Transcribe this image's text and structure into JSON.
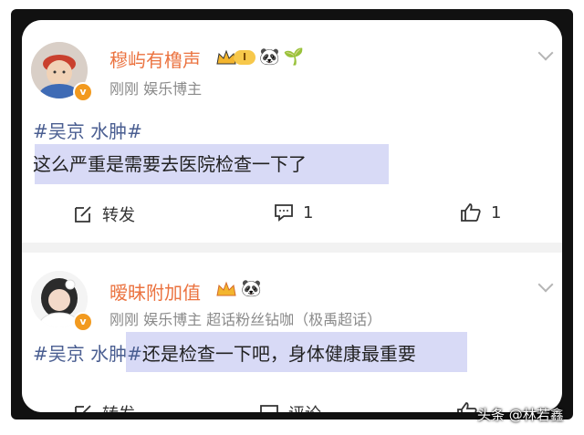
{
  "posts": [
    {
      "username": "穆屿有橹声",
      "level_badge": "I",
      "meta": "刚刚  娱乐博主",
      "hashtag": "#吴京 水肿#",
      "text_line2": "这么严重是需要去医院检查一下了",
      "actions": {
        "repost": "转发",
        "comment_count": "1",
        "like_count": "1"
      }
    },
    {
      "username": "暧昧附加值",
      "meta": "刚刚  娱乐博主 超话粉丝钻咖（极禹超话）",
      "hashtag": "#吴京 水肿#",
      "text": "还是检查一下吧，身体健康最重要",
      "actions": {
        "repost": "转发",
        "comment": "评论"
      }
    }
  ],
  "verified_mark": "v",
  "icons": [
    "crown-icon",
    "panda-icon",
    "sprout-icon",
    "edit-icon",
    "comment-icon",
    "thumbs-up-icon",
    "chevron-down-icon"
  ],
  "watermark": "头条 @林若鑫",
  "colors": {
    "username": "#eb7340",
    "hashtag": "#4a5e91",
    "highlight": "#d8daf6",
    "meta": "#8a8a8a"
  }
}
